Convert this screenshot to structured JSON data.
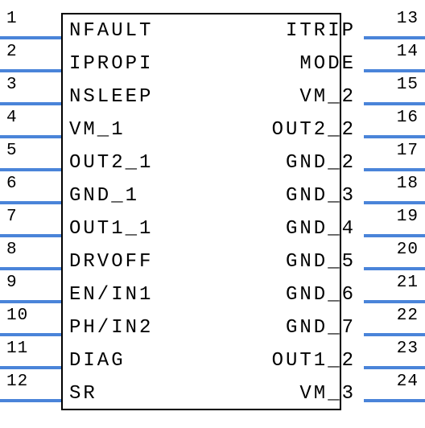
{
  "chip": {
    "left_pins": [
      {
        "num": "1",
        "label": "NFAULT"
      },
      {
        "num": "2",
        "label": "IPROPI"
      },
      {
        "num": "3",
        "label": "NSLEEP"
      },
      {
        "num": "4",
        "label": "VM_1"
      },
      {
        "num": "5",
        "label": "OUT2_1"
      },
      {
        "num": "6",
        "label": "GND_1"
      },
      {
        "num": "7",
        "label": "OUT1_1"
      },
      {
        "num": "8",
        "label": "DRVOFF"
      },
      {
        "num": "9",
        "label": "EN/IN1"
      },
      {
        "num": "10",
        "label": "PH/IN2"
      },
      {
        "num": "11",
        "label": "DIAG"
      },
      {
        "num": "12",
        "label": "SR"
      }
    ],
    "right_pins": [
      {
        "num": "13",
        "label": "ITRIP"
      },
      {
        "num": "14",
        "label": "MODE"
      },
      {
        "num": "15",
        "label": "VM_2"
      },
      {
        "num": "16",
        "label": "OUT2_2"
      },
      {
        "num": "17",
        "label": "GND_2"
      },
      {
        "num": "18",
        "label": "GND_3"
      },
      {
        "num": "19",
        "label": "GND_4"
      },
      {
        "num": "20",
        "label": "GND_5"
      },
      {
        "num": "21",
        "label": "GND_6"
      },
      {
        "num": "22",
        "label": "GND_7"
      },
      {
        "num": "23",
        "label": "OUT1_2"
      },
      {
        "num": "24",
        "label": "VM_3"
      }
    ]
  }
}
